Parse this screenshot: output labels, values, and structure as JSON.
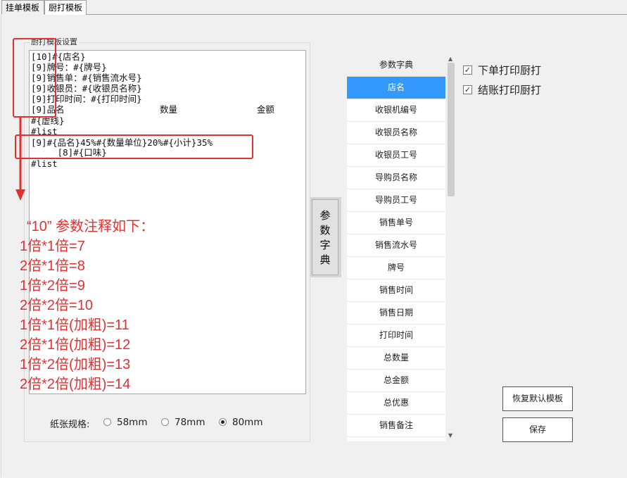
{
  "tabs": [
    {
      "label": "挂单模板"
    },
    {
      "label": "厨打模板"
    }
  ],
  "group_title": "厨打模板设置",
  "editor_lines": [
    "[10]#{店名}",
    "[9]牌号：#{牌号}",
    "[9]销售单：#{销售流水号}",
    "[9]收银员：#{收银员名称}",
    "[9]打印时间：#{打印时间}",
    "[9]品名                  数量               金额",
    "#{虚线}",
    "#list",
    "[9]#{品名}45%#{数量单位}20%#{小计}35%",
    "     [8]#{口味}",
    "#list"
  ],
  "notes": [
    "“10” 参数注释如下：",
    "1倍*1倍=7",
    "2倍*1倍=8",
    "1倍*2倍=9",
    "2倍*2倍=10",
    "1倍*1倍(加粗)=11",
    "2倍*1倍(加粗)=12",
    "1倍*2倍(加粗)=13",
    "2倍*2倍(加粗)=14"
  ],
  "paper": {
    "label": "纸张规格:",
    "options": [
      "58mm",
      "78mm",
      "80mm"
    ],
    "selected": "80mm"
  },
  "dict_button": {
    "label": "参数字典"
  },
  "dict_list": {
    "header": "参数字典",
    "selected": "店名",
    "items": [
      "店名",
      "收银机编号",
      "收银员名称",
      "收银员工号",
      "导购员名称",
      "导购员工号",
      "销售单号",
      "销售流水号",
      "牌号",
      "销售时间",
      "销售日期",
      "打印时间",
      "总数量",
      "总金额",
      "总优惠",
      "销售备注"
    ]
  },
  "checkboxes": [
    {
      "label": "下单打印厨打",
      "checked": true
    },
    {
      "label": "结账打印厨打",
      "checked": true
    }
  ],
  "buttons": {
    "restore": "恢复默认模板",
    "save": "保存"
  },
  "colors": {
    "annotation": "#e53030",
    "selection": "#3399ff"
  }
}
